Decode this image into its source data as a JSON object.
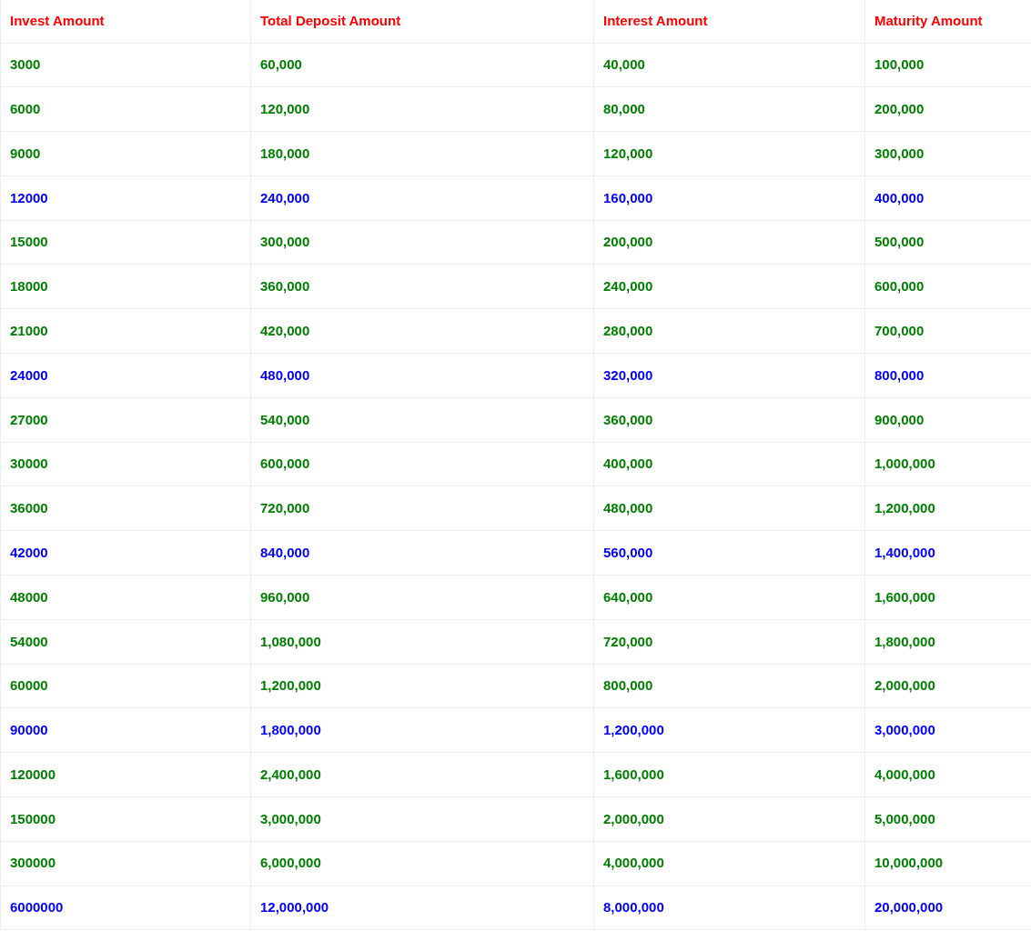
{
  "table": {
    "columns": [
      "Invest Amount",
      "Total Deposit Amount",
      "Interest Amount",
      "Maturity Amount"
    ],
    "rows": [
      {
        "color": "#008000",
        "cells": [
          "3000",
          "60,000",
          "40,000",
          "100,000"
        ]
      },
      {
        "color": "#008000",
        "cells": [
          "6000",
          "120,000",
          "80,000",
          "200,000"
        ]
      },
      {
        "color": "#008000",
        "cells": [
          "9000",
          "180,000",
          "120,000",
          "300,000"
        ]
      },
      {
        "color": "#0000ff",
        "cells": [
          "12000",
          "240,000",
          "160,000",
          "400,000"
        ]
      },
      {
        "color": "#008000",
        "cells": [
          "15000",
          "300,000",
          "200,000",
          "500,000"
        ]
      },
      {
        "color": "#008000",
        "cells": [
          "18000",
          "360,000",
          "240,000",
          "600,000"
        ]
      },
      {
        "color": "#008000",
        "cells": [
          "21000",
          "420,000",
          "280,000",
          "700,000"
        ]
      },
      {
        "color": "#0000ff",
        "cells": [
          "24000",
          "480,000",
          "320,000",
          "800,000"
        ]
      },
      {
        "color": "#008000",
        "cells": [
          "27000",
          "540,000",
          "360,000",
          "900,000"
        ]
      },
      {
        "color": "#008000",
        "cells": [
          "30000",
          "600,000",
          "400,000",
          "1,000,000"
        ]
      },
      {
        "color": "#008000",
        "cells": [
          "36000",
          "720,000",
          "480,000",
          "1,200,000"
        ]
      },
      {
        "color": "#0000ff",
        "cells": [
          "42000",
          "840,000",
          "560,000",
          "1,400,000"
        ]
      },
      {
        "color": "#008000",
        "cells": [
          "48000",
          "960,000",
          "640,000",
          "1,600,000"
        ]
      },
      {
        "color": "#008000",
        "cells": [
          "54000",
          "1,080,000",
          "720,000",
          "1,800,000"
        ]
      },
      {
        "color": "#008000",
        "cells": [
          "60000",
          "1,200,000",
          "800,000",
          "2,000,000"
        ]
      },
      {
        "color": "#0000ff",
        "cells": [
          "90000",
          "1,800,000",
          "1,200,000",
          "3,000,000"
        ]
      },
      {
        "color": "#008000",
        "cells": [
          "120000",
          "2,400,000",
          "1,600,000",
          "4,000,000"
        ]
      },
      {
        "color": "#008000",
        "cells": [
          "150000",
          "3,000,000",
          "2,000,000",
          "5,000,000"
        ]
      },
      {
        "color": "#008000",
        "cells": [
          "300000",
          "6,000,000",
          "4,000,000",
          "10,000,000"
        ]
      },
      {
        "color": "#0000ff",
        "cells": [
          "6000000",
          "12,000,000",
          "8,000,000",
          "20,000,000"
        ]
      }
    ]
  }
}
